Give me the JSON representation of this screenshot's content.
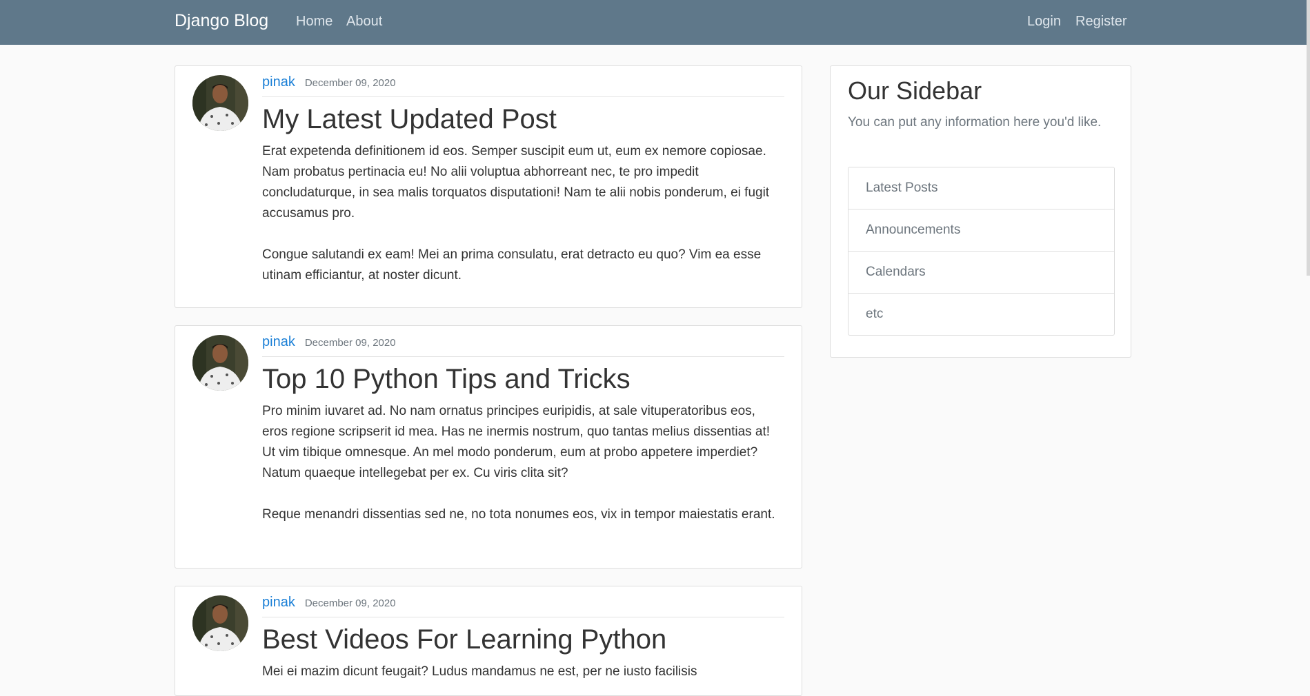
{
  "navbar": {
    "brand": "Django Blog",
    "links": {
      "home": "Home",
      "about": "About",
      "login": "Login",
      "register": "Register"
    },
    "background": "#5f788a"
  },
  "posts": [
    {
      "author": "pinak",
      "date": "December 09, 2020",
      "title": "My Latest Updated Post",
      "paragraphs": [
        "Erat expetenda definitionem id eos. Semper suscipit eum ut, eum ex nemore copiosae. Nam probatus pertinacia eu! No alii voluptua abhorreant nec, te pro impedit concludaturque, in sea malis torquatos disputationi! Nam te alii nobis ponderum, ei fugit accusamus pro.",
        "Congue salutandi ex eam! Mei an prima consulatu, erat detracto eu quo? Vim ea esse utinam efficiantur, at noster dicunt."
      ]
    },
    {
      "author": "pinak",
      "date": "December 09, 2020",
      "title": "Top 10 Python Tips and Tricks",
      "paragraphs": [
        "Pro minim iuvaret ad. No nam ornatus principes euripidis, at sale vituperatoribus eos, eros regione scripserit id mea. Has ne inermis nostrum, quo tantas melius dissentias at! Ut vim tibique omnesque. An mel modo ponderum, eum at probo appetere imperdiet? Natum quaeque intellegebat per ex. Cu viris clita sit?",
        "Reque menandri dissentias sed ne, no tota nonumes eos, vix in tempor maiestatis erant."
      ]
    },
    {
      "author": "pinak",
      "date": "December 09, 2020",
      "title": "Best Videos For Learning Python",
      "paragraphs": [
        "Mei ei mazim dicunt feugait? Ludus mandamus ne est, per ne iusto facilisis"
      ]
    }
  ],
  "sidebar": {
    "title": "Our Sidebar",
    "text": "You can put any information here you'd like.",
    "items": [
      "Latest Posts",
      "Announcements",
      "Calendars",
      "etc"
    ]
  },
  "colors": {
    "link": "#1a7fd6",
    "muted": "#6c757d",
    "page_bg": "#fafafa"
  }
}
